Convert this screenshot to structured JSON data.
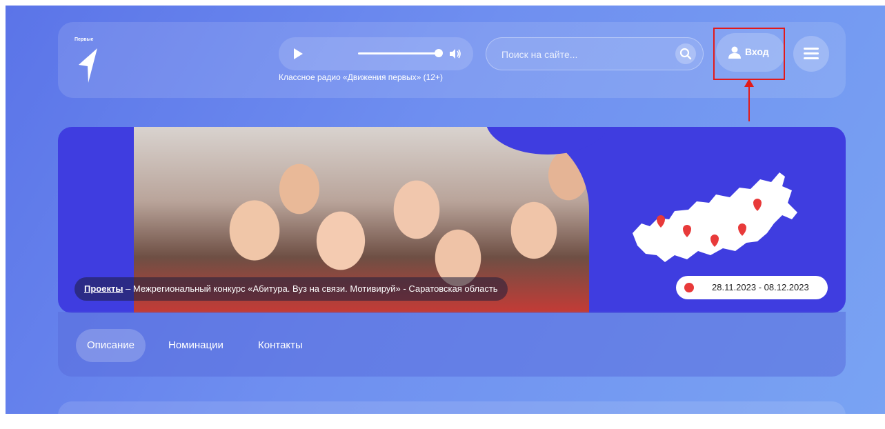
{
  "header": {
    "logo_text": "Первые",
    "radio": {
      "caption": "Классное радио «Движения первых» (12+)"
    },
    "search": {
      "placeholder": "Поиск на сайте..."
    },
    "login": {
      "label": "Вход"
    }
  },
  "banner": {
    "breadcrumb": {
      "link": "Проекты",
      "text": " – Межрегиональный конкурс «Абитура. Вуз на связи. Мотивируй» - Саратовская область"
    },
    "dates": "28.11.2023 - 08.12.2023"
  },
  "tabs": [
    {
      "label": "Описание",
      "active": true
    },
    {
      "label": "Номинации",
      "active": false
    },
    {
      "label": "Контакты",
      "active": false
    }
  ],
  "colors": {
    "accent": "#3f3de0",
    "highlight": "#e21a1a",
    "marker": "#e83a3a"
  }
}
